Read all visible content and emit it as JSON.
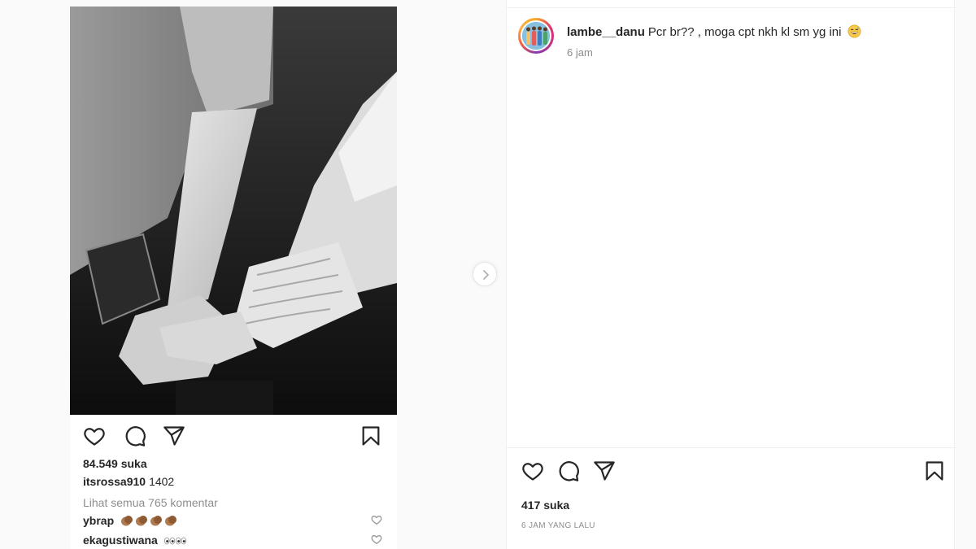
{
  "left_post": {
    "likes": "84.549 suka",
    "caption_user": "itsrossa910",
    "caption_text": "1402",
    "view_all_comments": "Lihat semua 765 komentar",
    "comments": [
      {
        "user": "ybrap",
        "emoji": [
          "clap-icon",
          "clap-icon",
          "clap-icon",
          "clap-icon"
        ]
      },
      {
        "user": "ekagustiwana",
        "emoji": [
          "eyes-icon",
          "eyes-icon"
        ]
      }
    ]
  },
  "right_post": {
    "username": "lambe__danu",
    "caption": "Pcr br?? , moga cpt nkh kl sm yg ini",
    "caption_emoji": "grinning-sweat-face-icon",
    "posted": "6 jam",
    "likes": "417 suka",
    "timestamp": "6 JAM YANG LALU"
  },
  "colors": {
    "text": "#262626",
    "muted": "#8e8e8e",
    "border": "#efefef",
    "background": "#fafafa"
  }
}
